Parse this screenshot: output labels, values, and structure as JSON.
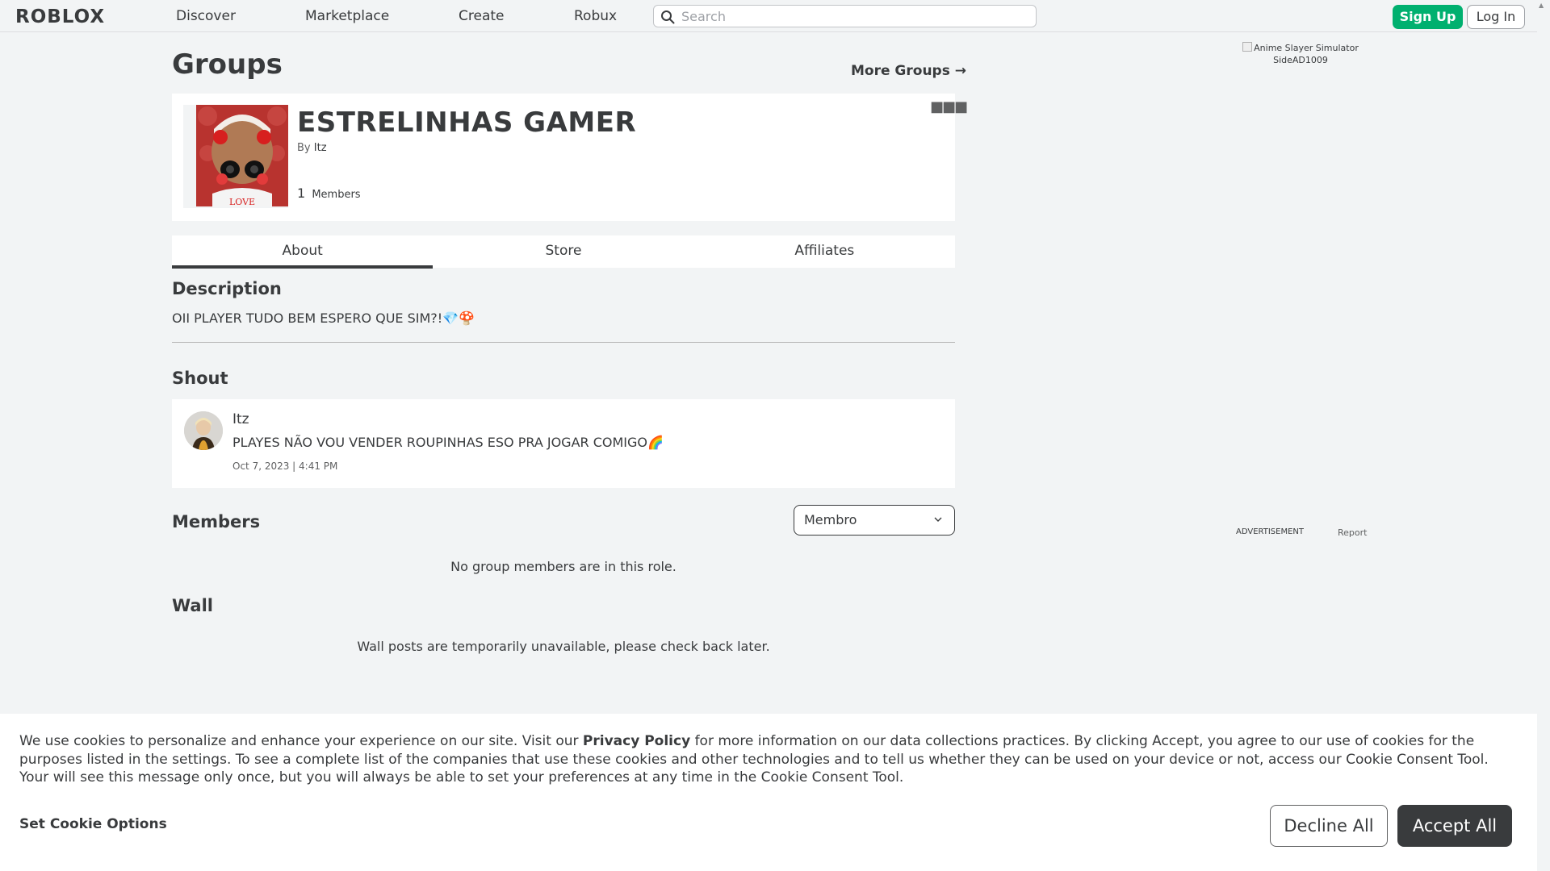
{
  "nav": {
    "logo": "ROBLOX",
    "links": [
      "Discover",
      "Marketplace",
      "Create",
      "Robux"
    ],
    "search_placeholder": "Search",
    "signup": "Sign Up",
    "login": "Log In"
  },
  "page": {
    "title": "Groups",
    "more_groups": "More Groups →"
  },
  "group": {
    "name": "ESTRELINHAS GAMER",
    "by_label": "By",
    "owner": "Itz",
    "member_count": "1",
    "members_label": "Members",
    "more_icon": "ellipsis-icon"
  },
  "tabs": [
    {
      "label": "About",
      "active": true
    },
    {
      "label": "Store",
      "active": false
    },
    {
      "label": "Affiliates",
      "active": false
    }
  ],
  "description": {
    "heading": "Description",
    "text": "OII PLAYER TUDO BEM ESPERO QUE SIM?!💎🍄"
  },
  "shout": {
    "heading": "Shout",
    "user": "Itz",
    "text": "PLAYES NÃO VOU VENDER ROUPINHAS ESO PRA JOGAR COMIGO🌈",
    "date": "Oct 7, 2023 | 4:41 PM"
  },
  "members": {
    "heading": "Members",
    "role_selected": "Membro",
    "empty_msg": "No group members are in this role."
  },
  "wall": {
    "heading": "Wall",
    "msg": "Wall posts are temporarily unavailable, please check back later."
  },
  "ad": {
    "alt_text": "Anime Slayer Simulator SideAD1009",
    "label": "ADVERTISEMENT",
    "report": "Report"
  },
  "cookie": {
    "text_before": "We use cookies to personalize and enhance your experience on our site. Visit our ",
    "privacy_link": "Privacy Policy",
    "text_after": " for more information on our data collections practices. By clicking Accept, you agree to our use of cookies for the purposes listed in the settings. To see a complete list of the companies that use these cookies and other technologies and to tell us whether they can be used on your device or not, access our Cookie Consent Tool. Your will see this message only once, but you will always be able to set your preferences at any time in the Cookie Consent Tool.",
    "set_options": "Set Cookie Options",
    "decline": "Decline All",
    "accept": "Accept All"
  }
}
